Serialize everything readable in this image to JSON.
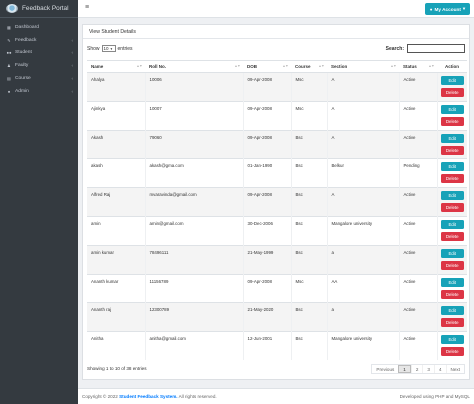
{
  "brand": {
    "title": "Feedback Portal"
  },
  "sidebar": {
    "items": [
      {
        "label": "Dashboard",
        "icon": "dashboard-icon",
        "caret": ""
      },
      {
        "label": "Feedback",
        "icon": "edit-icon",
        "caret": "‹"
      },
      {
        "label": "Student",
        "icon": "users-icon",
        "caret": "‹"
      },
      {
        "label": "Faulty",
        "icon": "user-tie-icon",
        "caret": "‹"
      },
      {
        "label": "Course",
        "icon": "book-icon",
        "caret": "‹"
      },
      {
        "label": "Admin",
        "icon": "user-icon",
        "caret": "‹"
      }
    ]
  },
  "topbar": {
    "account_label": "My Account",
    "account_caret": "▾"
  },
  "card": {
    "title": "View Student Details"
  },
  "controls": {
    "show_label": "Show",
    "entries_value": "10",
    "entries_label": "entries",
    "search_label": "Search:"
  },
  "table": {
    "headers": [
      "Name",
      "Roll No.",
      "DOB",
      "Course",
      "Section",
      "Status",
      "Action"
    ],
    "rows": [
      {
        "name": "Ahalya",
        "roll": "10006",
        "dob": "09-Apr-2008",
        "course": "Msc",
        "section": "A",
        "status": "Active"
      },
      {
        "name": "Ajinkya",
        "roll": "10007",
        "dob": "09-Apr-2008",
        "course": "Msc",
        "section": "A",
        "status": "Active"
      },
      {
        "name": "Akash",
        "roll": "79060",
        "dob": "09-Apr-2008",
        "course": "Bsc",
        "section": "A",
        "status": "Active"
      },
      {
        "name": "akash",
        "roll": "akash@gma.com",
        "dob": "01-Jan-1990",
        "course": "Bsc",
        "section": "Belkur",
        "status": "Pending"
      },
      {
        "name": "Alfred Raj",
        "roll": "mvaravinda@gmail.com",
        "dob": "09-Apr-2008",
        "course": "Bsc",
        "section": "A",
        "status": "Active"
      },
      {
        "name": "amin",
        "roll": "amin@gmail.com",
        "dob": "30-Dec-2006",
        "course": "Bsc",
        "section": "Mangalore university",
        "status": "Active"
      },
      {
        "name": "amin kumar",
        "roll": "78496111",
        "dob": "21-May-1999",
        "course": "Bsc",
        "section": "a",
        "status": "Active"
      },
      {
        "name": "Ananth kumar",
        "roll": "11156789",
        "dob": "09-Apr-2008",
        "course": "Msc",
        "section": "AA",
        "status": "Active"
      },
      {
        "name": "Ananth raj",
        "roll": "12300789",
        "dob": "21-May-2020",
        "course": "Bsc",
        "section": "a",
        "status": "Active"
      },
      {
        "name": "Anitha",
        "roll": "anitha@gmail.com",
        "dob": "12-Jun-2001",
        "course": "Bsc",
        "section": "Mangalore university",
        "status": "Active"
      }
    ],
    "edit_label": "Edit",
    "delete_label": "Delete"
  },
  "pagination": {
    "info": "Showing 1 to 10 of 38 entries",
    "previous": "Previous",
    "pages": [
      "1",
      "2",
      "3",
      "4"
    ],
    "next": "Next"
  },
  "footer": {
    "copyright_prefix": "Copyright © 2022",
    "system_name": "Student Feedback System.",
    "rights": "All rights reserved.",
    "developed": "Developed using PHP and MySQL"
  },
  "colors": {
    "sidebar": "#343a40",
    "accent": "#17a2b8",
    "danger": "#dc3545",
    "link": "#007bff"
  }
}
